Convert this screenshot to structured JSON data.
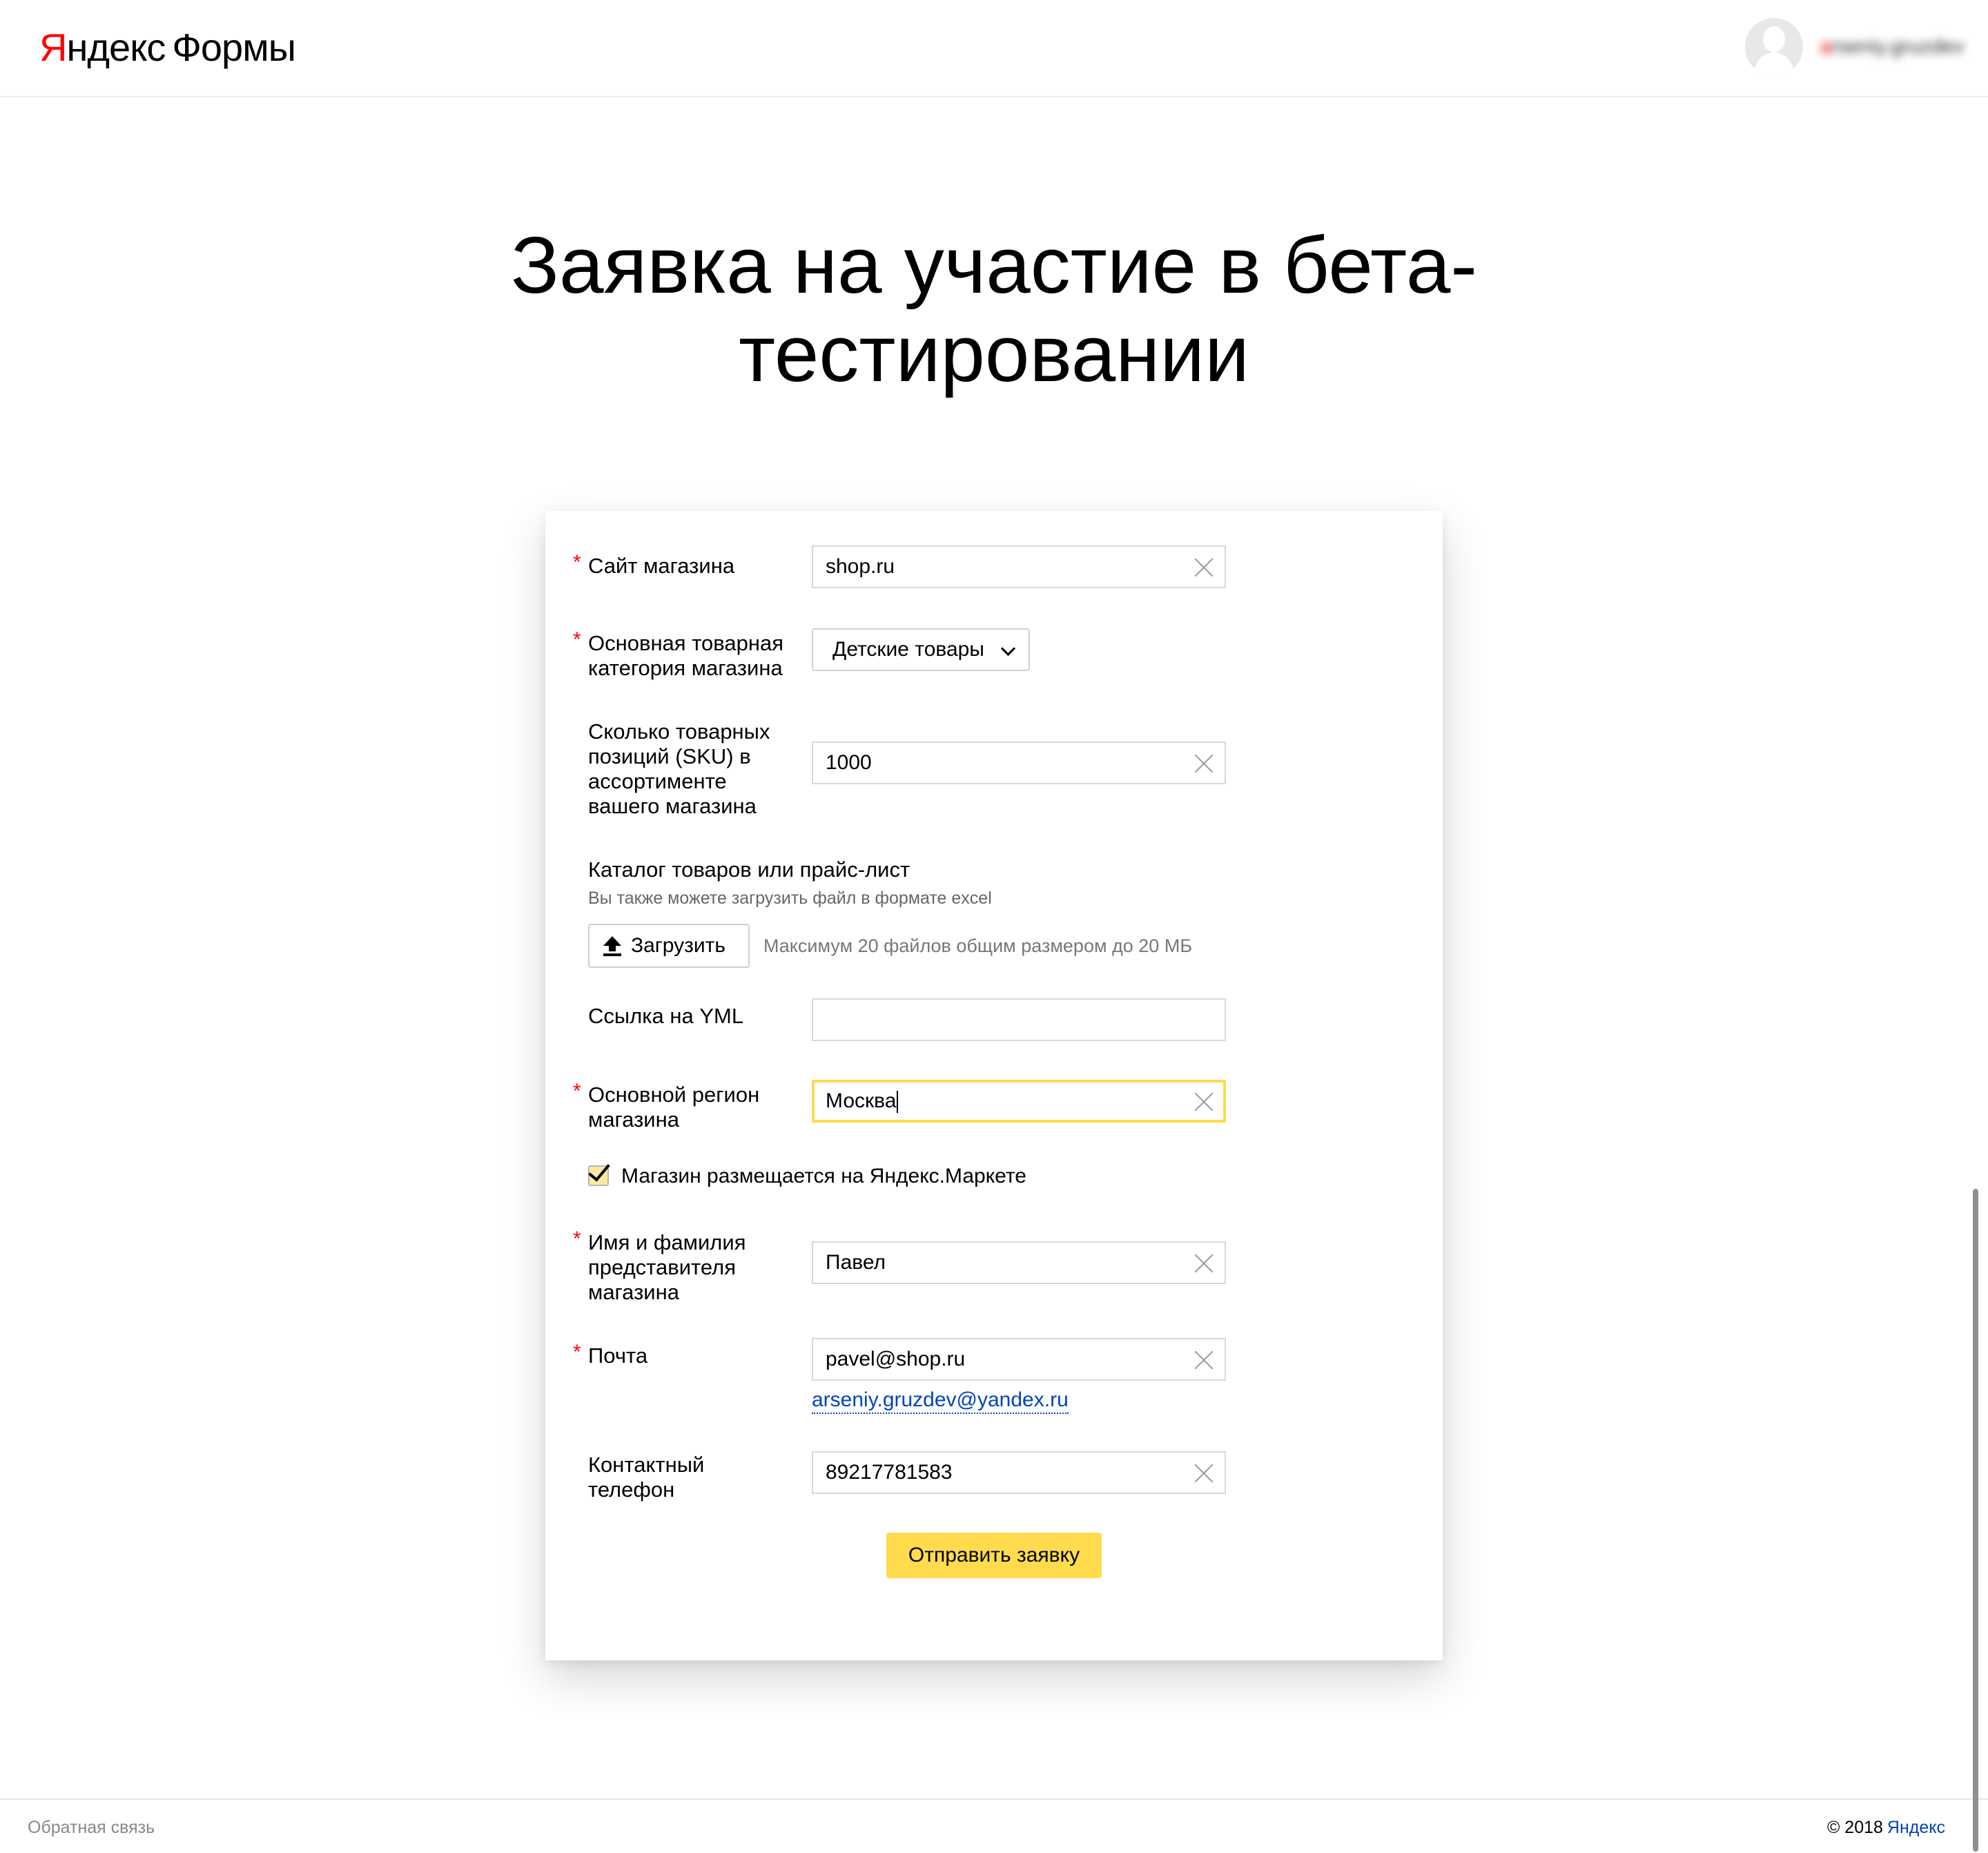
{
  "header": {
    "logo_first_letter": "Я",
    "logo_rest": "ндекс",
    "product": "Формы",
    "username": "arseniy.gruzdev",
    "username_first_letter": "a"
  },
  "title": "Заявка на участие в бета-тестировании",
  "form": {
    "required_mark": "*",
    "site": {
      "label": "Сайт магазина",
      "value": "shop.ru"
    },
    "category": {
      "label": "Основная товарная категория магазина",
      "value": "Детские товары"
    },
    "sku": {
      "label": "Сколько товарных позиций (SKU) в ассортименте вашего магазина",
      "value": "1000"
    },
    "catalog": {
      "title": "Каталог товаров или прайс-лист",
      "hint": "Вы также можете загрузить файл в формате excel",
      "upload_label": "Загрузить",
      "upload_note": "Максимум 20 файлов общим размером до 20 МБ"
    },
    "yml": {
      "label": "Ссылка на YML",
      "value": ""
    },
    "region": {
      "label": "Основной регион магазина",
      "value": "Москва"
    },
    "market_checkbox": {
      "label": "Магазин размещается на Яндекс.Маркете",
      "checked": true
    },
    "name": {
      "label": "Имя и фамилия представителя магазина",
      "value": "Павел"
    },
    "email": {
      "label": "Почта",
      "value": "pavel@shop.ru",
      "suggestion": "arseniy.gruzdev@yandex.ru"
    },
    "phone": {
      "label": "Контактный телефон",
      "value": "89217781583"
    },
    "submit_label": "Отправить заявку"
  },
  "footer": {
    "feedback": "Обратная связь",
    "copyright": "© 2018",
    "yandex_link": "Яндекс"
  },
  "colors": {
    "accent": "#ffdb4d",
    "required": "#ff0000",
    "link": "#0044bb"
  }
}
